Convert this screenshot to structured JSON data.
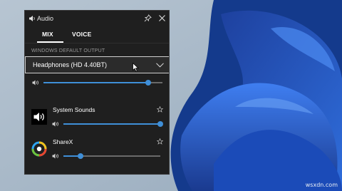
{
  "widget": {
    "title": "Audio",
    "tabs": [
      {
        "label": "MIX",
        "active": true
      },
      {
        "label": "VOICE",
        "active": false
      }
    ],
    "output_section_label": "WINDOWS DEFAULT OUTPUT",
    "output_device": "Headphones (HD 4.40BT)",
    "master_volume": 0.88,
    "apps": [
      {
        "name": "System Sounds",
        "icon": "speaker-app-icon",
        "volume": 1.0
      },
      {
        "name": "ShareX",
        "icon": "sharex-app-icon",
        "volume": 0.18
      }
    ],
    "accent_color": "#3f8fd8"
  },
  "watermark": "wsxdn.com"
}
